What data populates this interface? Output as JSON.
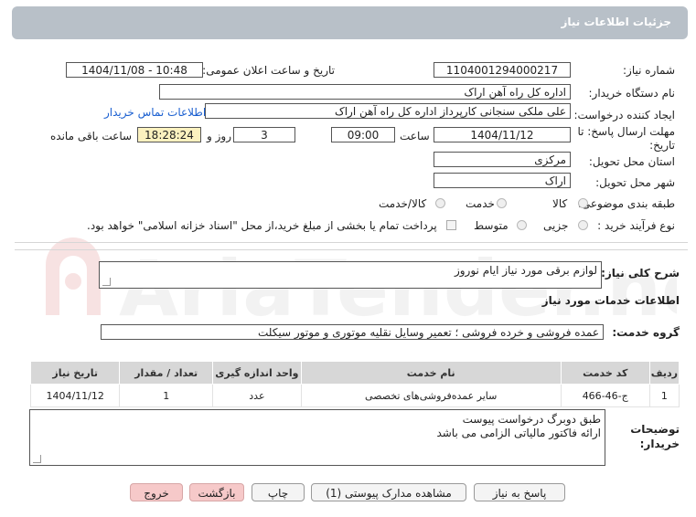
{
  "header": {
    "title": "جزئیات اطلاعات نیاز"
  },
  "form": {
    "need_number_label": "شماره نیاز:",
    "need_number_value": "1104001294000217",
    "announce_label": "تاریخ و ساعت اعلان عمومی:",
    "announce_value": "1404/11/08 - 10:48",
    "buyer_org_label": "نام دستگاه خریدار:",
    "buyer_org_value": "اداره کل راه آهن اراک",
    "creator_label": "ایجاد کننده درخواست:",
    "creator_value": "علی ملکی سنجانی کارپرداز اداره کل راه آهن اراک",
    "contact_link": "اطلاعات تماس خریدار",
    "deadline_label": "مهلت ارسال پاسخ: تا تاریخ:",
    "deadline_date": "1404/11/12",
    "time_label": "ساعت",
    "deadline_time": "09:00",
    "days_value": "3",
    "days_label": "روز و",
    "remaining_time": "18:28:24",
    "remaining_label": "ساعت باقی مانده",
    "province_label": "استان محل تحویل:",
    "province_value": "مرکزی",
    "city_label": "شهر محل تحویل:",
    "city_value": "اراک",
    "category_label": "طبقه بندی موضوعی:",
    "category_options": [
      "کالا",
      "خدمت",
      "کالا/خدمت"
    ],
    "process_label": "نوع فرآیند خرید :",
    "process_options": [
      "جزیی",
      "متوسط"
    ],
    "process_note": "پرداخت تمام یا بخشی از مبلغ خرید،از محل \"اسناد خزانه اسلامی\" خواهد بود."
  },
  "description": {
    "label": "شرح کلی نیاز:",
    "value": "لوازم برقی مورد نیاز ایام نوروز"
  },
  "services": {
    "section_title": "اطلاعات خدمات مورد نیاز",
    "group_label": "گروه خدمت:",
    "group_value": "عمده فروشی و خرده فروشی ؛ تعمیر وسایل نقلیه موتوری و موتور سیکلت",
    "columns": [
      "ردیف",
      "کد خدمت",
      "نام خدمت",
      "واحد اندازه گیری",
      "تعداد / مقدار",
      "تاریخ نیاز"
    ],
    "rows": [
      [
        "1",
        "ج-46-466",
        "سایر عمده‌فروشی‌های تخصصی",
        "عدد",
        "1",
        "1404/11/12"
      ]
    ]
  },
  "buyer_notes": {
    "label": "توضیحات خریدار:",
    "line1": "طبق دوبرگ  درخواست پیوست",
    "line2": "ارائه فاکتور مالیاتی الزامی می باشد"
  },
  "buttons": {
    "reply": "پاسخ به نیاز",
    "view_docs": "مشاهده مدارک پیوستی (1)",
    "print": "چاپ",
    "back": "بازگشت",
    "exit": "خروج"
  },
  "watermark": {
    "text": "AriaTender.net"
  }
}
